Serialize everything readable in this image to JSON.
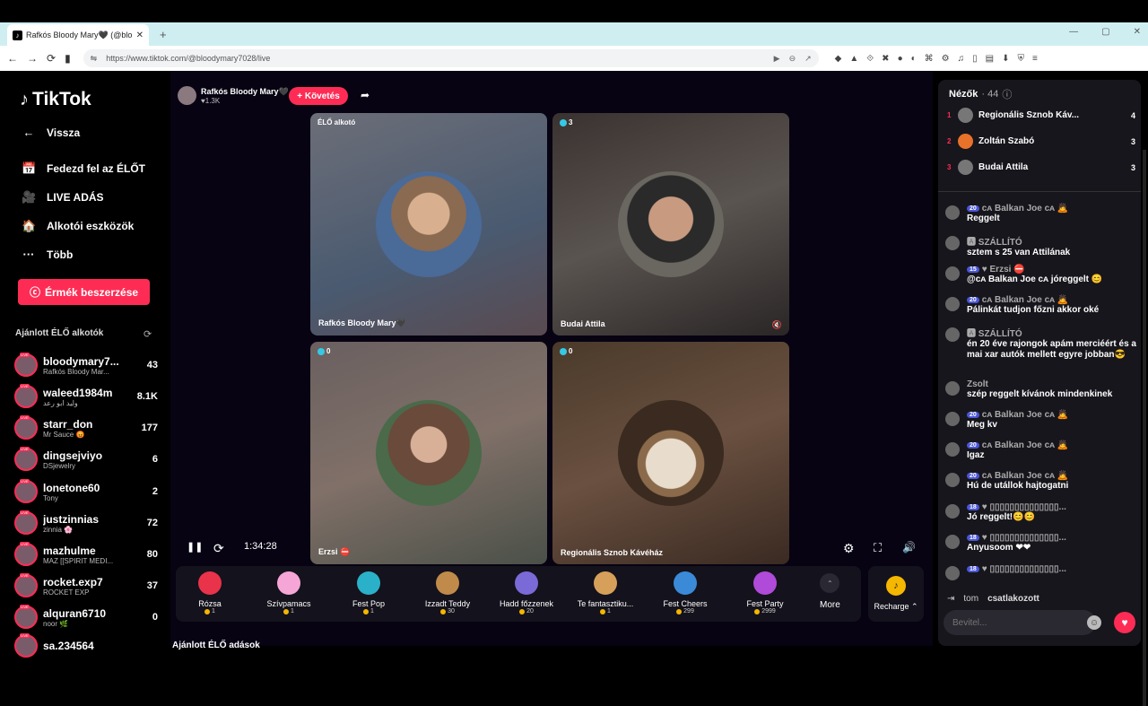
{
  "browser": {
    "tab_title": "Rafkós Bloody Mary🖤 (@blo",
    "tab_close": "✕",
    "new_tab": "+",
    "url": "https://www.tiktok.com/@bloodymary7028/live",
    "window_controls": [
      "—",
      "▢",
      "✕"
    ]
  },
  "sidebar": {
    "logo": "TikTok",
    "back": "Vissza",
    "nav": [
      {
        "label": "Fedezd fel az ÉLŐT",
        "icon": "📅"
      },
      {
        "label": "LIVE ADÁS",
        "icon": "🎥"
      },
      {
        "label": "Alkotói eszközök",
        "icon": "🏠"
      },
      {
        "label": "Több",
        "icon": "···"
      }
    ],
    "get_coins": "Érmék beszerzése",
    "recommended_title": "Ajánlott ÉLŐ alkotók",
    "creators": [
      {
        "name": "bloodymary7...",
        "sub": "Rafkós Bloody Mar...",
        "count": "43"
      },
      {
        "name": "waleed1984m",
        "sub": "وليد ابو رعد",
        "count": "8.1K"
      },
      {
        "name": "starr_don",
        "sub": "Mr Sauce 😡",
        "count": "177"
      },
      {
        "name": "dingsejviyo",
        "sub": "DSjewelry",
        "count": "6"
      },
      {
        "name": "lonetone60",
        "sub": "Tony",
        "count": "2"
      },
      {
        "name": "justzinnias",
        "sub": "zinnia 🌸",
        "count": "72"
      },
      {
        "name": "mazhulme",
        "sub": "MAZ [[SPIRIT MEDI...",
        "count": "80"
      },
      {
        "name": "rocket.exp7",
        "sub": "ROCKET EXP",
        "count": "37"
      },
      {
        "name": "alquran6710",
        "sub": "noor 🌿",
        "count": "0"
      },
      {
        "name": "sa.234564",
        "sub": "",
        "count": ""
      }
    ]
  },
  "stage": {
    "host_name": "Rafkós Bloody Mary🖤",
    "host_likes": "♥1.3K",
    "follow": "+ Követés",
    "tiles": [
      {
        "top": "ÉLŐ alkotó",
        "label": "Rafkós Bloody Mary🖤"
      },
      {
        "top": "3",
        "label": "Budai Attila"
      },
      {
        "top": "0",
        "label": "Erzsi ⛔"
      },
      {
        "top": "0",
        "label": "Regionális Sznob Kávéház"
      }
    ],
    "timer": "1:34:28",
    "gifts": [
      {
        "name": "Rózsa",
        "price": "1",
        "color": "#e8334a"
      },
      {
        "name": "Szívpamacs",
        "price": "1",
        "color": "#f5a6d6"
      },
      {
        "name": "Fest Pop",
        "price": "1",
        "color": "#2bb0c9"
      },
      {
        "name": "Izzadt Teddy",
        "price": "30",
        "color": "#c08a4a"
      },
      {
        "name": "Hadd főzzenek",
        "price": "20",
        "color": "#7a6ad8"
      },
      {
        "name": "Te fantasztiku...",
        "price": "1",
        "color": "#d6a05a"
      },
      {
        "name": "Fest Cheers",
        "price": "299",
        "color": "#3a8ad8"
      },
      {
        "name": "Fest Party",
        "price": "2999",
        "color": "#b04ad8"
      }
    ],
    "more": "More",
    "recharge": "Recharge ⌃",
    "bottom_hint": "Ajánlott ÉLŐ adások"
  },
  "chat": {
    "viewers_label": "Nézők",
    "viewers_count": "· 44",
    "top_viewers": [
      {
        "rank": "1",
        "name": "Regionális Sznob Káv...",
        "count": "4"
      },
      {
        "rank": "2",
        "name": "Zoltán Szabó",
        "count": "3"
      },
      {
        "rank": "3",
        "name": "Budai Attila",
        "count": "3"
      }
    ],
    "messages": [
      {
        "badge": "20",
        "user": "ᴄᴀ Balkan Joe ᴄᴀ 🙇",
        "text": "Reggelt"
      },
      {
        "badge": "",
        "user": "🅰 SZÁLLÍTÓ",
        "text": "sztem s 25 van Attilának"
      },
      {
        "badge": "15",
        "user": "♥ Erzsi ⛔",
        "text": "@ᴄᴀ Balkan Joe ᴄᴀ jóreggelt 😊"
      },
      {
        "badge": "20",
        "user": "ᴄᴀ Balkan Joe ᴄᴀ 🙇",
        "text": "Pálinkát tudjon főzni akkor oké"
      },
      {
        "badge": "",
        "user": "🅰 SZÁLLÍTÓ",
        "text": "én 20 éve rajongok apám merciéért és a mai xar autók mellett egyre jobban😎"
      },
      {
        "badge": "",
        "user": "Zsolt",
        "text": "szép reggelt kívánok mindenkinek"
      },
      {
        "badge": "20",
        "user": "ᴄᴀ Balkan Joe ᴄᴀ 🙇",
        "text": "Meg kv"
      },
      {
        "badge": "20",
        "user": "ᴄᴀ Balkan Joe ᴄᴀ 🙇",
        "text": "Igaz"
      },
      {
        "badge": "20",
        "user": "ᴄᴀ Balkan Joe ᴄᴀ 🙇",
        "text": "Hú de utállok hajtogatni"
      },
      {
        "badge": "18",
        "user": "♥ ▯▯▯▯▯▯▯▯▯▯▯▯▯▯...",
        "text": "Jó reggelt!😊😊"
      },
      {
        "badge": "18",
        "user": "♥ ▯▯▯▯▯▯▯▯▯▯▯▯▯▯...",
        "text": "Anyusoom ❤❤"
      },
      {
        "badge": "18",
        "user": "♥ ▯▯▯▯▯▯▯▯▯▯▯▯▯▯...",
        "text": ""
      }
    ],
    "join_user": "tom",
    "join_text": "csatlakozott",
    "input_placeholder": "Bevitel..."
  }
}
